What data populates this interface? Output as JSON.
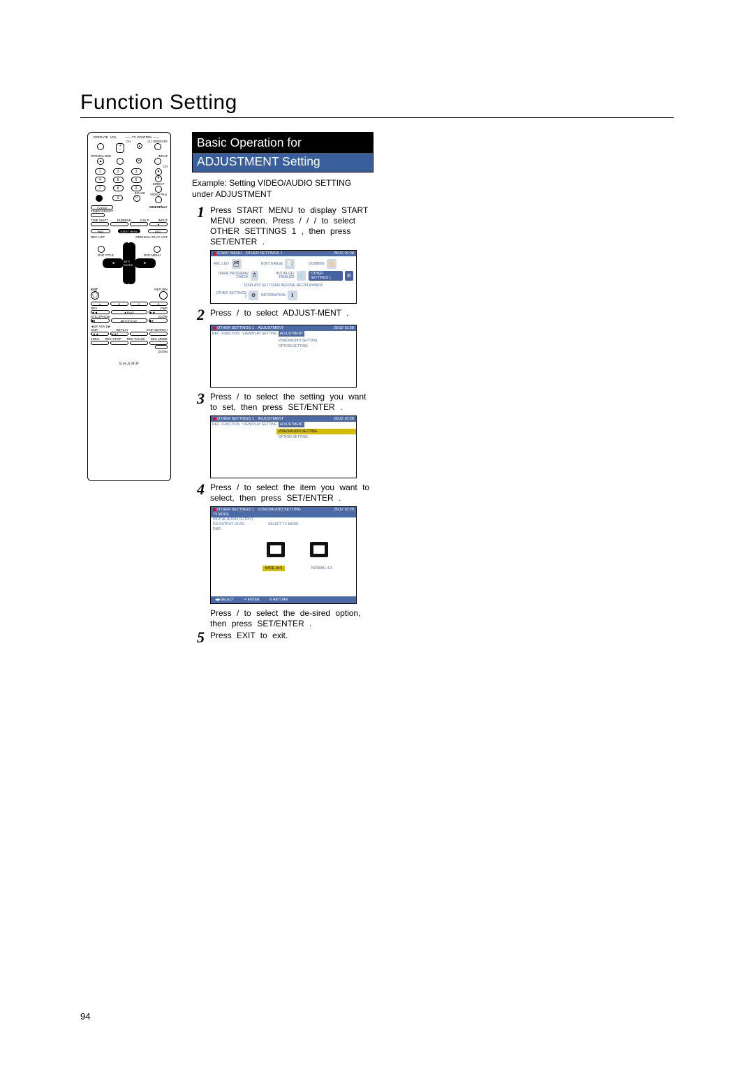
{
  "heading": "Function Setting",
  "page_number": "94",
  "remote": {
    "top_labels": {
      "operate": "OPERATE",
      "vol": "VOL",
      "tv_control": "TV CONTROL",
      "ch": "CH",
      "operate_r": "OPERATE",
      "open_close": "OPEN/CLOSE",
      "input": "INPUT",
      "ch_r": "CH",
      "direct": "DIRECT",
      "erase": "ERASE",
      "videoplus": "VIDEO Plus",
      "tvdvd": "TV/DVD",
      "video_plus": "VIDEOPlus+",
      "timer": "TIMER ON/OFF",
      "timeshift": "TIME SHIFT",
      "dubbing": "DUBBING",
      "pinp": "P IN P",
      "input2": "INPUT",
      "hdd": "HDD",
      "start_menu": "START MENU",
      "dvd": "DVD",
      "rec_list": "REC LIST",
      "original_playlist": "ORIGINAL/\nPLAY LIST",
      "dvd_title": "DVD TITLE",
      "dvd_menu": "DVD MENU",
      "set_enter": "SET/\nENTER",
      "exit": "EXIT",
      "return": "RETURN",
      "a": "A",
      "b": "B",
      "c": "C",
      "d": "D",
      "rev": "REV",
      "fwd": "FWD",
      "play": "►PLAY",
      "still_pause": "STILL/PAUSE",
      "slow": "SLOW",
      "stop_live": "■STOP/LIVE",
      "fadv": "◄|| F.ADV ||►",
      "skip_l": "SKIP",
      "replay": "REPLAY",
      "skip_search": "SKIP\nSEARCH",
      "rec": "●REC",
      "rec_stop": "REC\nSTOP",
      "rec_pause": "REC\nPAUSE",
      "rec_mode": "REC\nMODE",
      "zoom": "ZOOM"
    },
    "brand": "SHARP"
  },
  "box": {
    "title1": "Basic Operation for",
    "title2": "ADJUSTMENT Setting"
  },
  "example_line1": "Example:  Setting  VIDEO/AUDIO SETTING",
  "example_line2": "under  ADJUSTMENT",
  "steps": {
    "s1": "Press  START MENU    to display   START MENU   screen. Press      /    /    /    to select  OTHER SETTINGS 1  , then press  SET/ENTER  .",
    "s2": "Press      /      to select    ADJUST-MENT  .",
    "s3": "Press      /      to select the setting you want to set, then press     SET/ENTER  .",
    "s4a": "Press      /      to select the item you want to select, then press SET/ENTER  .",
    "s4b": "Press      /      to select the de-sired option, then press    SET/ENTER  .",
    "s5": "Press  EXIT  to exit."
  },
  "screen1": {
    "title": "START MENU",
    "crumb": "OTHER SETTINGS 1",
    "clock": "25/12 10:28",
    "cells": {
      "rec_list": "REC LIST",
      "edit_erase": "EDIT/\nERASE",
      "dubbing": "DUBBING",
      "timer": "TIMER\nPROGRAM/\nCHECK",
      "init": "INITIALIZE/\nFINALIZE",
      "other": "OTHER\nSETTINGS 1",
      "other2": "OTHER\nSETTINGS 2",
      "info": "INFORMATION"
    },
    "hint": "DISPLAYS SET ITEMS BEFORE REC/PLAYBACK"
  },
  "screen2": {
    "crumb1": "OTHER SETTINGS 1",
    "crumb2": "ADJUSTMENT",
    "clock": "25/12 10:28",
    "tabs": {
      "a": "REC. FUNCTION",
      "b": "VIEW/PLAY SETTING",
      "c": "ADJUSTMENT"
    },
    "items": {
      "a": "VIDEO/AUDIO SETTING",
      "b": "OPTION SETTING"
    }
  },
  "screen3": {
    "crumb1": "OTHER SETTINGS 1",
    "crumb2": "ADJUSTMENT",
    "clock": "25/12 10:28",
    "tabs": {
      "a": "REC. FUNCTION",
      "b": "VIEW/PLAY SETTING",
      "c": "ADJUSTMENT"
    },
    "items": {
      "a": "VIDEO/AUDIO SETTING",
      "b": "OPTION SETTING"
    }
  },
  "screen4": {
    "crumb1": "OTHER SETTINGS 1",
    "crumb2": "VIDEO/AUDIO SETTING",
    "clock": "25/12 10:28",
    "sidelist": {
      "a": "TV MODE",
      "b": "DIGITAL AUDIO OUTPUT",
      "c": "DD OUTPUT LEVEL",
      "d": "DNR"
    },
    "midhint": "SELECT TV MODE.",
    "opt_wide": "WIDE 16:9",
    "opt_normal": "NORMAL 4:3",
    "footer": {
      "sel": "◀▶SELECT",
      "ent": "⏎ ENTER",
      "ret": "⟲ RETURN"
    }
  }
}
